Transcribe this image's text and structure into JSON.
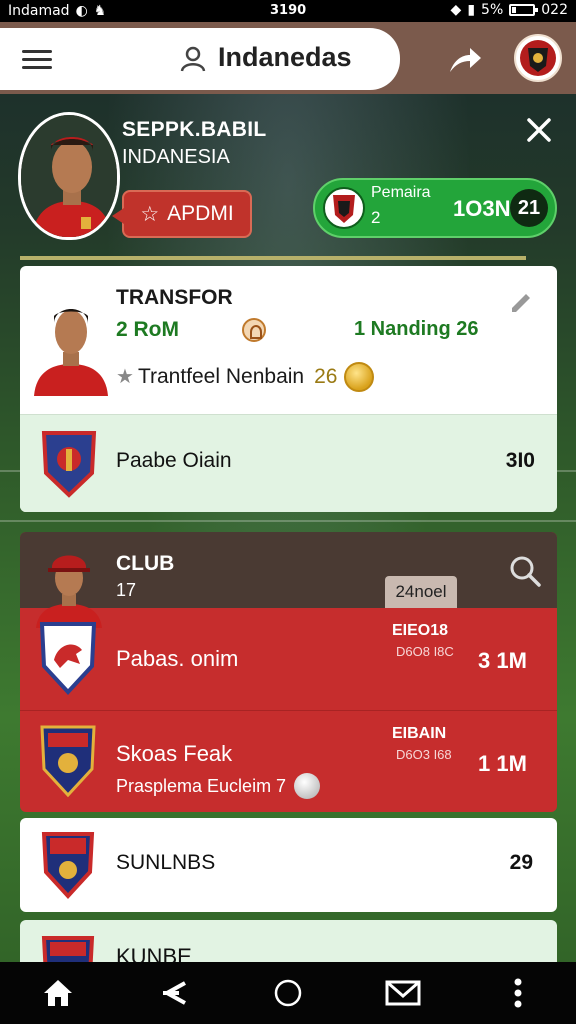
{
  "status_bar": {
    "carrier": "Indamad",
    "time": "3190",
    "battery_text": "5%",
    "clock": "022",
    "battery_level": 0.2
  },
  "top_bar": {
    "title": "Indanedas"
  },
  "profile": {
    "name": "SEPPK.BABIL",
    "country": "INDANESIA",
    "apply_label": "APDMI",
    "stats": {
      "label": "Pemaira",
      "sub": "2",
      "value": "1O3N",
      "number": "21"
    }
  },
  "transfer_card": {
    "title": "TRANSFOR",
    "rating": "2 RoM",
    "ranking": "1 Nanding 26",
    "transfer_text": "Trantfeel Nenbain",
    "transfer_num": "26",
    "sub_name": "Paabe Oiain",
    "sub_value": "3I0"
  },
  "club_card": {
    "title": "CLUB",
    "count": "17",
    "tag": "24noel",
    "rows": [
      {
        "name": "Pabas. onim",
        "detail": "",
        "code": "EIEO18",
        "code2": "D6O8 I8C",
        "price": "3  1M"
      },
      {
        "name": "Skoas Feak",
        "detail": "Prasplema Eucleim  7",
        "code": "EIBAIN",
        "code2": "D6O3 I68",
        "price": "1  1M"
      }
    ]
  },
  "list_rows": [
    {
      "name": "SUNLNBS",
      "value": "29"
    },
    {
      "name": "KUNBE",
      "value": ""
    }
  ],
  "colors": {
    "accent_red": "#c62d2d",
    "accent_green": "#23a53a",
    "topbar_brown": "#7b5a4c"
  }
}
